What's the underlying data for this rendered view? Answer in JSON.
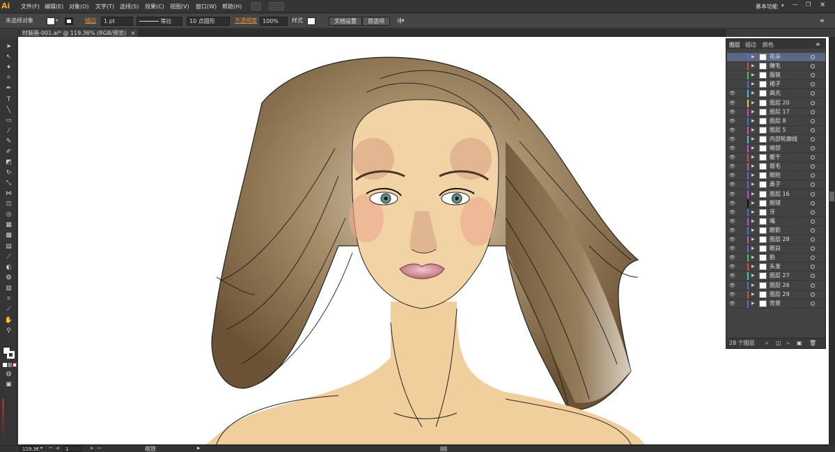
{
  "menubar": {
    "logo": "Ai",
    "items": [
      "文件(F)",
      "编辑(E)",
      "对象(O)",
      "文字(T)",
      "选择(S)",
      "效果(C)",
      "视图(V)",
      "窗口(W)",
      "帮助(H)"
    ],
    "workspace": "基本功能"
  },
  "control": {
    "selection": "未选择对象",
    "stroke_label": "描边",
    "stroke_weight": "1 pt",
    "profile": "等比",
    "brush": "10 点圆形",
    "opacity_label": "不透明度",
    "opacity": "100%",
    "style_label": "样式",
    "doc_setup": "文档设置",
    "prefs": "首选项"
  },
  "document": {
    "tab": "时装画-001.ai* @ 119.36% (RGB/预览)",
    "close": "×"
  },
  "layers_panel": {
    "tabs": [
      "图层",
      "描边",
      "颜色"
    ],
    "layers": [
      {
        "name": "花朵",
        "color": "#4d6fd8",
        "eye": false,
        "selected": true
      },
      {
        "name": "睫毛",
        "color": "#d84b4b",
        "eye": false
      },
      {
        "name": "服装",
        "color": "#4bc24b",
        "eye": false
      },
      {
        "name": "裙子",
        "color": "#4d6fd8",
        "eye": false
      },
      {
        "name": "高光",
        "color": "#3fc6c6",
        "eye": true
      },
      {
        "name": "图层 20",
        "color": "#d8c84b",
        "eye": true
      },
      {
        "name": "图层 17",
        "color": "#c84bc8",
        "eye": true
      },
      {
        "name": "图层 8",
        "color": "#4d6fd8",
        "eye": true
      },
      {
        "name": "图层 5",
        "color": "#c84bc8",
        "eye": true
      },
      {
        "name": "内部轮廓线",
        "color": "#3fc6c6",
        "eye": true
      },
      {
        "name": "暗部",
        "color": "#c84bc8",
        "eye": true
      },
      {
        "name": "躯干",
        "color": "#d84b4b",
        "eye": true
      },
      {
        "name": "眉毛",
        "color": "#c84bc8",
        "eye": true
      },
      {
        "name": "眼睑",
        "color": "#4d6fd8",
        "eye": true
      },
      {
        "name": "鼻子",
        "color": "#4d6fd8",
        "eye": true
      },
      {
        "name": "图层 16",
        "color": "#c84bc8",
        "eye": true
      },
      {
        "name": "眼球",
        "color": "#111111",
        "eye": true
      },
      {
        "name": "牙",
        "color": "#4d6fd8",
        "eye": true
      },
      {
        "name": "嘴",
        "color": "#c84bc8",
        "eye": true
      },
      {
        "name": "眼影",
        "color": "#4d6fd8",
        "eye": true
      },
      {
        "name": "图层 28",
        "color": "#c84bc8",
        "eye": true
      },
      {
        "name": "眼白",
        "color": "#4d6fd8",
        "eye": true
      },
      {
        "name": "脸",
        "color": "#4bc24b",
        "eye": true
      },
      {
        "name": "头发",
        "color": "#d84b4b",
        "eye": true
      },
      {
        "name": "图层 27",
        "color": "#3fc6c6",
        "eye": true
      },
      {
        "name": "图层 26",
        "color": "#4d6fd8",
        "eye": true
      },
      {
        "name": "图层 29",
        "color": "#d84b4b",
        "eye": true
      },
      {
        "name": "背景",
        "color": "#4d6fd8",
        "eye": true
      }
    ],
    "footer": "28 个图层"
  },
  "status": {
    "zoom": "119.3€",
    "page": "1",
    "tool": "缩放"
  }
}
